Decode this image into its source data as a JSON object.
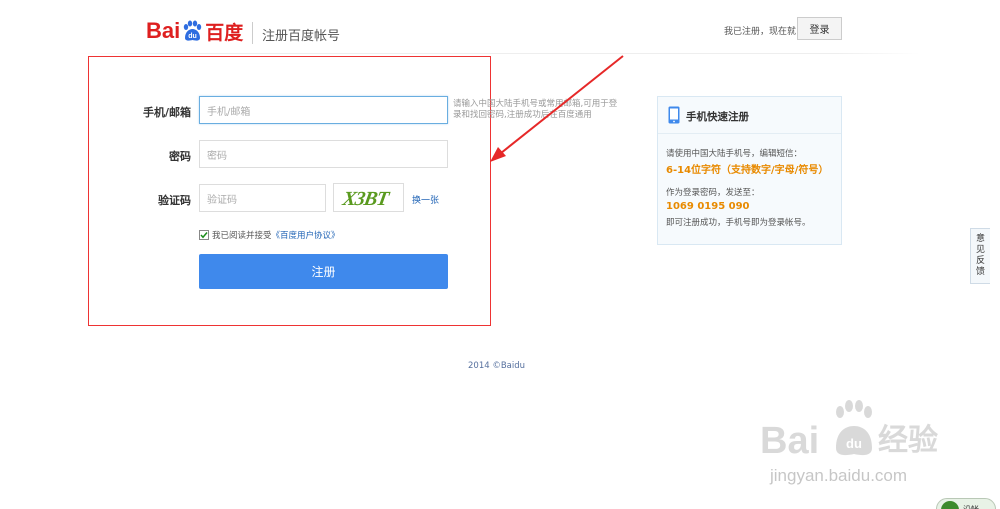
{
  "header": {
    "logo_bai": "Bai",
    "logo_du": "du",
    "logo_cn": "百度",
    "title": "注册百度帐号",
    "already_text": "我已注册，现在就",
    "login_label": "登录"
  },
  "form": {
    "phone_label": "手机/邮箱",
    "phone_placeholder": "手机/邮箱",
    "phone_hint": "请输入中国大陆手机号或常用邮箱,可用于登录和找回密码,注册成功后在百度通用",
    "password_label": "密码",
    "password_placeholder": "密码",
    "captcha_label": "验证码",
    "captcha_placeholder": "验证码",
    "captcha_text": "X3BT",
    "refresh_label": "换一张",
    "agree_text": "我已阅读并接受",
    "agree_link": "《百度用户协议》",
    "agree_checked": true,
    "submit_label": "注册"
  },
  "side": {
    "title": "手机快速注册",
    "line1": "请使用中国大陆手机号，编辑短信：",
    "emph1": "6-14位字符（支持数字/字母/符号）",
    "line2": "作为登录密码，发送至：",
    "emph2": "1069 0195 090",
    "line3": "即可注册成功，手机号即为登录帐号。"
  },
  "footer": {
    "copyright": "2014 ©Baidu"
  },
  "feedback": {
    "c1": "意",
    "c2": "见",
    "c3": "反",
    "c4": "馈"
  },
  "watermark": {
    "brand": "Bai",
    "brand2": "du",
    "cn": "经验",
    "url": "jingyan.baidu.com"
  },
  "corner": {
    "label": "沿帐"
  },
  "colors": {
    "brand_red": "#de1f1f",
    "primary_blue": "#3f89ec",
    "link_blue": "#1f63b5",
    "emphasis_orange": "#e88a00",
    "annotation_red": "#ee3333"
  }
}
